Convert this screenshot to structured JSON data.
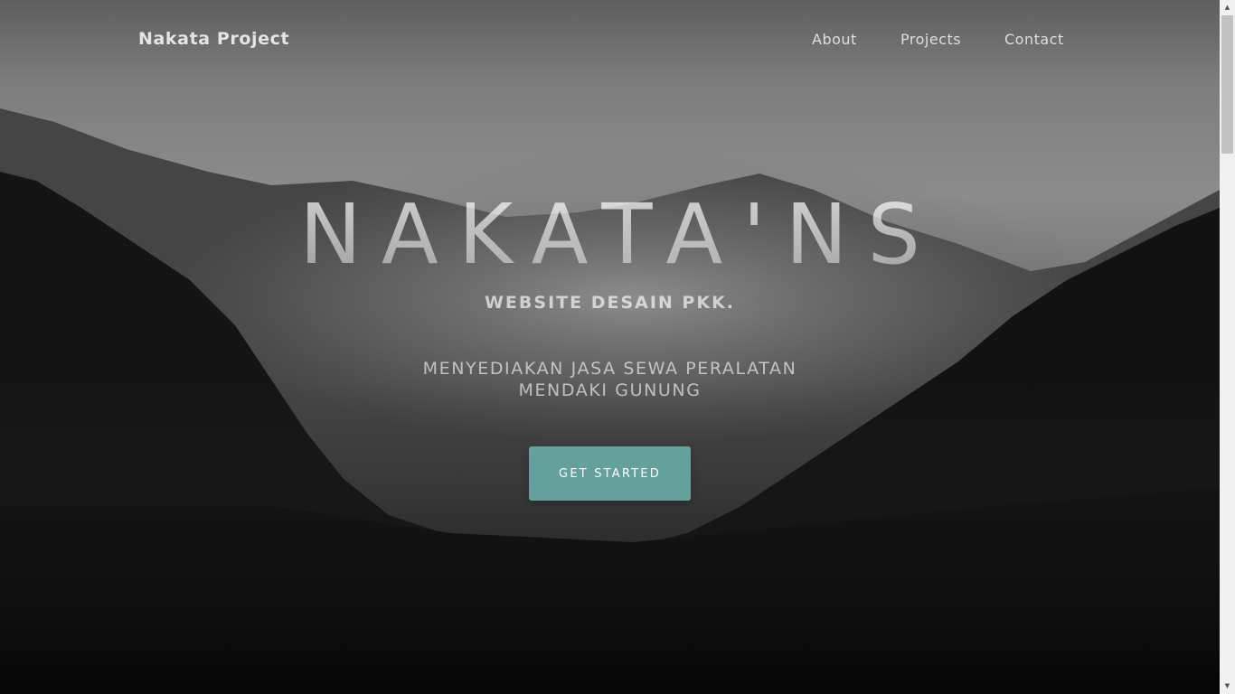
{
  "nav": {
    "brand": "Nakata Project",
    "links": [
      {
        "label": "About"
      },
      {
        "label": "Projects"
      },
      {
        "label": "Contact"
      }
    ]
  },
  "hero": {
    "title": "NAKATA'NS",
    "subtitle": "WEBSITE DESAIN PKK.",
    "description": "MENYEDIAKAN JASA SEWA PERALATAN MENDAKI GUNUNG",
    "cta_label": "GET STARTED"
  },
  "colors": {
    "accent": "#64a19d",
    "sky": "#8a8a8a",
    "forest": "#0e0e0e"
  },
  "icons": {
    "scroll_up": "triangle-up-icon",
    "scroll_down": "triangle-down-icon"
  }
}
